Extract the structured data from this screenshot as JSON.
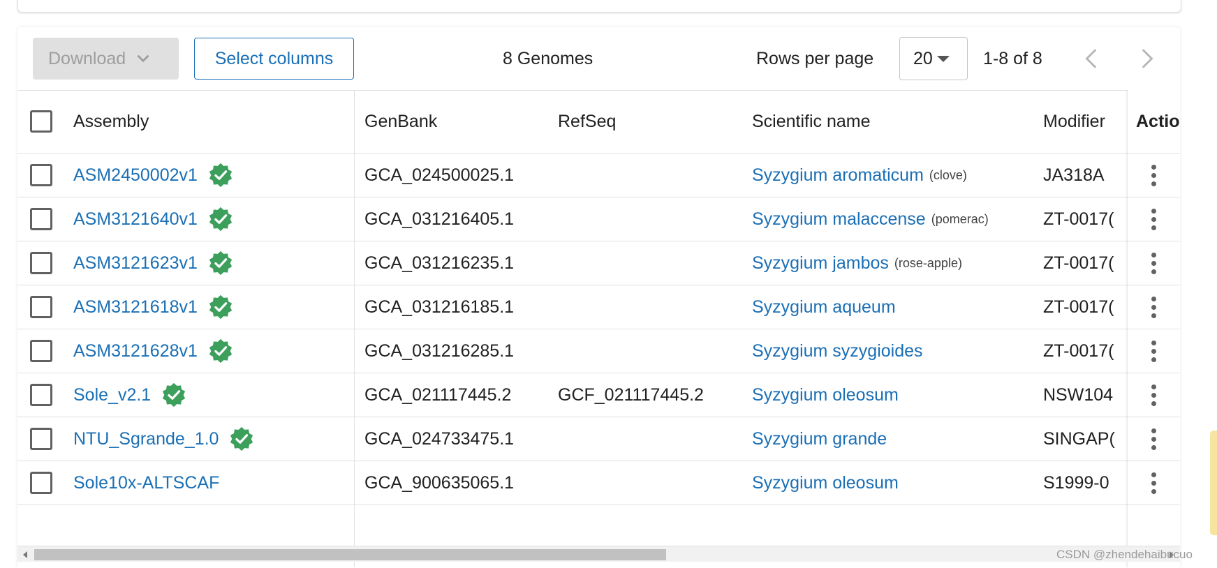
{
  "toolbar": {
    "download_label": "Download",
    "select_columns_label": "Select columns",
    "count_label": "8 Genomes",
    "rows_per_page_label": "Rows per page",
    "rows_per_page_value": "20",
    "range_label": "1-8 of 8"
  },
  "table": {
    "headers": {
      "assembly": "Assembly",
      "genbank": "GenBank",
      "refseq": "RefSeq",
      "scientific_name": "Scientific name",
      "modifier": "Modifier",
      "action": "Actio"
    },
    "rows": [
      {
        "assembly": "ASM2450002v1",
        "verified": true,
        "genbank": "GCA_024500025.1",
        "refseq": "",
        "scientific_name": "Syzygium aromaticum",
        "common_name": "(clove)",
        "modifier": "JA318A"
      },
      {
        "assembly": "ASM3121640v1",
        "verified": true,
        "genbank": "GCA_031216405.1",
        "refseq": "",
        "scientific_name": "Syzygium malaccense",
        "common_name": "(pomerac)",
        "modifier": "ZT-0017("
      },
      {
        "assembly": "ASM3121623v1",
        "verified": true,
        "genbank": "GCA_031216235.1",
        "refseq": "",
        "scientific_name": "Syzygium jambos",
        "common_name": "(rose-apple)",
        "modifier": "ZT-0017("
      },
      {
        "assembly": "ASM3121618v1",
        "verified": true,
        "genbank": "GCA_031216185.1",
        "refseq": "",
        "scientific_name": "Syzygium aqueum",
        "common_name": "",
        "modifier": "ZT-0017("
      },
      {
        "assembly": "ASM3121628v1",
        "verified": true,
        "genbank": "GCA_031216285.1",
        "refseq": "",
        "scientific_name": "Syzygium syzygioides",
        "common_name": "",
        "modifier": "ZT-0017("
      },
      {
        "assembly": "Sole_v2.1",
        "verified": true,
        "genbank": "GCA_021117445.2",
        "refseq": "GCF_021117445.2",
        "scientific_name": "Syzygium oleosum",
        "common_name": "",
        "modifier": "NSW104"
      },
      {
        "assembly": "NTU_Sgrande_1.0",
        "verified": true,
        "genbank": "GCA_024733475.1",
        "refseq": "",
        "scientific_name": "Syzygium grande",
        "common_name": "",
        "modifier": "SINGAP("
      },
      {
        "assembly": "Sole10x-ALTSCAF",
        "verified": false,
        "genbank": "GCA_900635065.1",
        "refseq": "",
        "scientific_name": "Syzygium oleosum",
        "common_name": "",
        "modifier": "S1999-0"
      }
    ]
  },
  "watermark": "CSDN @zhendehaibucuo",
  "colors": {
    "link": "#1a6fb5",
    "verified_badge": "#3d9f5c",
    "disabled_button_bg": "#e0e0e0"
  }
}
